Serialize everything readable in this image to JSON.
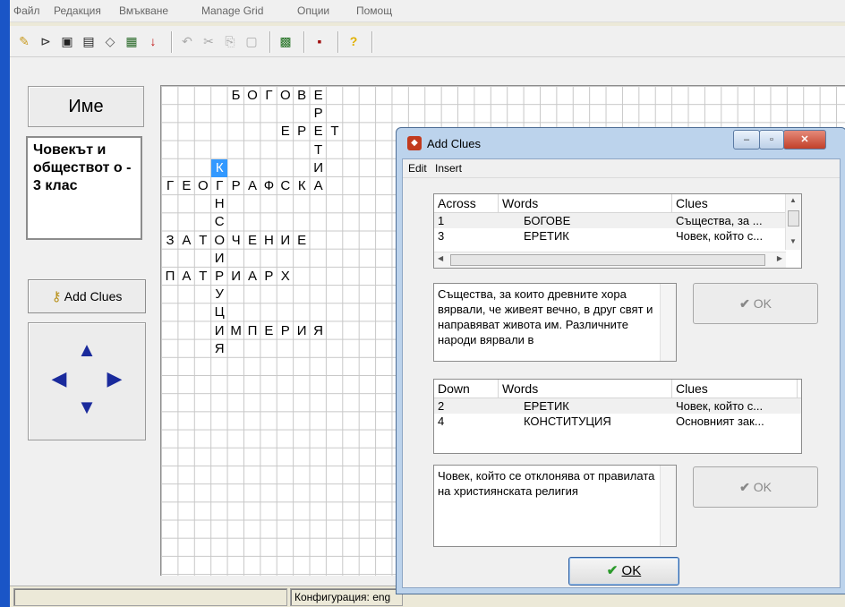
{
  "menu": [
    "Файл",
    "Редакция",
    "Вмъкване",
    "Manage Grid",
    "Опции",
    "Помощ"
  ],
  "toolbar_icons": [
    "new-file-icon",
    "open-folder-icon",
    "save-icon",
    "save-all-icon",
    "eraser-icon",
    "grid-pattern-icon",
    "down-arrow-icon",
    "undo-icon",
    "cut-icon",
    "copy-icon",
    "paste-icon",
    "generate-grid-icon",
    "print-icon",
    "help-icon"
  ],
  "left_panel": {
    "name_label": "Име",
    "topic_text": "Човекът и обществот о - 3 клас",
    "add_clues_label": "Add Clues"
  },
  "grid": {
    "cells": [
      {
        "r": 0,
        "c": 4,
        "ch": "Б"
      },
      {
        "r": 0,
        "c": 5,
        "ch": "О"
      },
      {
        "r": 0,
        "c": 6,
        "ch": "Г"
      },
      {
        "r": 0,
        "c": 7,
        "ch": "О"
      },
      {
        "r": 0,
        "c": 8,
        "ch": "В"
      },
      {
        "r": 0,
        "c": 9,
        "ch": "Е"
      },
      {
        "r": 1,
        "c": 9,
        "ch": "Р"
      },
      {
        "r": 2,
        "c": 7,
        "ch": "Е"
      },
      {
        "r": 2,
        "c": 8,
        "ch": "Р"
      },
      {
        "r": 2,
        "c": 9,
        "ch": "Е"
      },
      {
        "r": 2,
        "c": 10,
        "ch": "Т"
      },
      {
        "r": 3,
        "c": 9,
        "ch": "Т"
      },
      {
        "r": 4,
        "c": 3,
        "ch": "К",
        "sel": true
      },
      {
        "r": 4,
        "c": 9,
        "ch": "И"
      },
      {
        "r": 5,
        "c": 0,
        "ch": "Г"
      },
      {
        "r": 5,
        "c": 1,
        "ch": "Е"
      },
      {
        "r": 5,
        "c": 2,
        "ch": "О"
      },
      {
        "r": 5,
        "c": 3,
        "ch": "Г"
      },
      {
        "r": 5,
        "c": 4,
        "ch": "Р"
      },
      {
        "r": 5,
        "c": 5,
        "ch": "А"
      },
      {
        "r": 5,
        "c": 6,
        "ch": "Ф"
      },
      {
        "r": 5,
        "c": 7,
        "ch": "С"
      },
      {
        "r": 5,
        "c": 8,
        "ch": "К"
      },
      {
        "r": 5,
        "c": 9,
        "ch": "А"
      },
      {
        "r": 6,
        "c": 3,
        "ch": "Н"
      },
      {
        "r": 7,
        "c": 3,
        "ch": "С"
      },
      {
        "r": 8,
        "c": 0,
        "ch": "З"
      },
      {
        "r": 8,
        "c": 1,
        "ch": "А"
      },
      {
        "r": 8,
        "c": 2,
        "ch": "Т"
      },
      {
        "r": 8,
        "c": 3,
        "ch": "О"
      },
      {
        "r": 8,
        "c": 4,
        "ch": "Ч"
      },
      {
        "r": 8,
        "c": 5,
        "ch": "Е"
      },
      {
        "r": 8,
        "c": 6,
        "ch": "Н"
      },
      {
        "r": 8,
        "c": 7,
        "ch": "И"
      },
      {
        "r": 8,
        "c": 8,
        "ch": "Е"
      },
      {
        "r": 9,
        "c": 3,
        "ch": "И"
      },
      {
        "r": 10,
        "c": 0,
        "ch": "П"
      },
      {
        "r": 10,
        "c": 1,
        "ch": "А"
      },
      {
        "r": 10,
        "c": 2,
        "ch": "Т"
      },
      {
        "r": 10,
        "c": 3,
        "ch": "Р"
      },
      {
        "r": 10,
        "c": 4,
        "ch": "И"
      },
      {
        "r": 10,
        "c": 5,
        "ch": "А"
      },
      {
        "r": 10,
        "c": 6,
        "ch": "Р"
      },
      {
        "r": 10,
        "c": 7,
        "ch": "Х"
      },
      {
        "r": 11,
        "c": 3,
        "ch": "У"
      },
      {
        "r": 12,
        "c": 3,
        "ch": "Ц"
      },
      {
        "r": 13,
        "c": 3,
        "ch": "И"
      },
      {
        "r": 13,
        "c": 4,
        "ch": "М"
      },
      {
        "r": 13,
        "c": 5,
        "ch": "П"
      },
      {
        "r": 13,
        "c": 6,
        "ch": "Е"
      },
      {
        "r": 13,
        "c": 7,
        "ch": "Р"
      },
      {
        "r": 13,
        "c": 8,
        "ch": "И"
      },
      {
        "r": 13,
        "c": 9,
        "ch": "Я"
      },
      {
        "r": 14,
        "c": 3,
        "ch": "Я"
      }
    ]
  },
  "status": {
    "config": "Конфигурация: eng"
  },
  "dialog": {
    "title": "Add Clues",
    "menu": [
      "Edit",
      "Insert"
    ],
    "across": {
      "headers": [
        "Across",
        "Words",
        "Clues"
      ],
      "rows": [
        {
          "num": "1",
          "word": "БОГОВЕ",
          "clue": "Същества, за ..."
        },
        {
          "num": "3",
          "word": "ЕРЕТИК",
          "clue": "Човек, който с..."
        }
      ],
      "clue_text": "Същества, за които древните хора вярвали, че живеят вечно, в друг свят и направяват живота им. Различните народи вярвали в",
      "ok_label": "OK"
    },
    "down": {
      "headers": [
        "Down",
        "Words",
        "Clues"
      ],
      "rows": [
        {
          "num": "2",
          "word": "ЕРЕТИК",
          "clue": "Човек, който с..."
        },
        {
          "num": "4",
          "word": "КОНСТИТУЦИЯ",
          "clue": "Основният зак..."
        }
      ],
      "clue_text": "Човек, който се отклонява от правилата на християнската религия",
      "ok_label": "OK"
    },
    "ok_label": "OK"
  }
}
